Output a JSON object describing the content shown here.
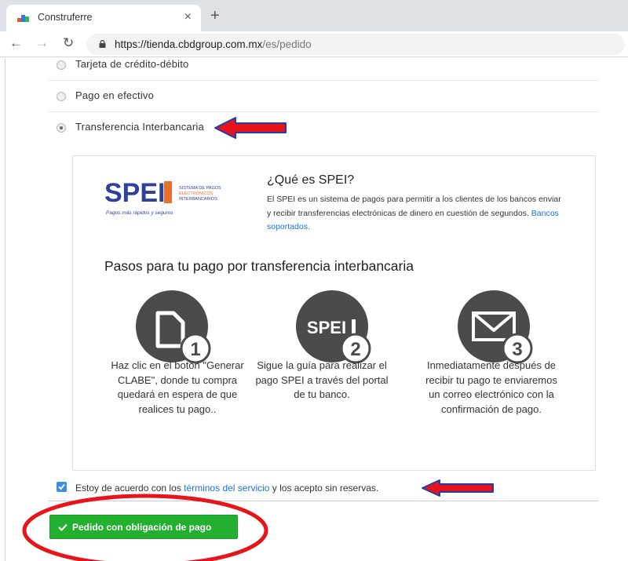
{
  "browser": {
    "tab_title": "Construferre",
    "tab_close": "×",
    "new_tab": "+",
    "url_host": "https://tienda.cbdgroup.com.mx",
    "url_path": "/es/pedido"
  },
  "payment_options": [
    {
      "label": "Tarjeta de crédito-débito",
      "selected": false
    },
    {
      "label": "Pago en efectivo",
      "selected": false
    },
    {
      "label": "Transferencia Interbancaria",
      "selected": true
    }
  ],
  "spei": {
    "logo_text": "SPEI",
    "logo_sub_1": "SISTEMA DE PAGOS",
    "logo_sub_2": "ELECTRÓNICOS",
    "logo_sub_3": "INTERBANCARIOS",
    "logo_tagline": "Pagos más rápidos y seguros",
    "title": "¿Qué es SPEI?",
    "description": "El SPEI es un sistema de pagos para permitir a los clientes de los bancos enviar y recibir transferencias electrónicas de dinero en cuestión de segundos.",
    "link": "Bancos soportados.",
    "steps_title": "Pasos para tu pago por transferencia interbancaria",
    "steps": [
      {
        "number": "1",
        "icon": "document-icon",
        "text": "Haz clic en el botón \"Generar CLABE\", donde tu compra quedará en espera de que realices tu pago.."
      },
      {
        "number": "2",
        "icon": "spei-icon",
        "icon_label": "SPEI",
        "text": "Sigue la guía para realizar el pago SPEI a través del portal de tu banco."
      },
      {
        "number": "3",
        "icon": "envelope-icon",
        "text": "Inmediatamente después de recibir tu pago te enviaremos un correo electrónico con la confirmación de pago."
      }
    ]
  },
  "terms": {
    "checked": true,
    "prefix": "Estoy de acuerdo con los ",
    "link": "términos del servicio",
    "suffix": " y los acepto sin reservas."
  },
  "order_button": {
    "label": "Pedido con obligación de pago"
  },
  "colors": {
    "annotation_red": "#e8141b",
    "arrow_blue": "#1f3fa8",
    "button_green": "#22b02e",
    "spei_blue": "#2f3f9e",
    "spei_orange": "#e8702a",
    "icon_gray": "#4b4b4b",
    "link_blue": "#1a73e8"
  }
}
